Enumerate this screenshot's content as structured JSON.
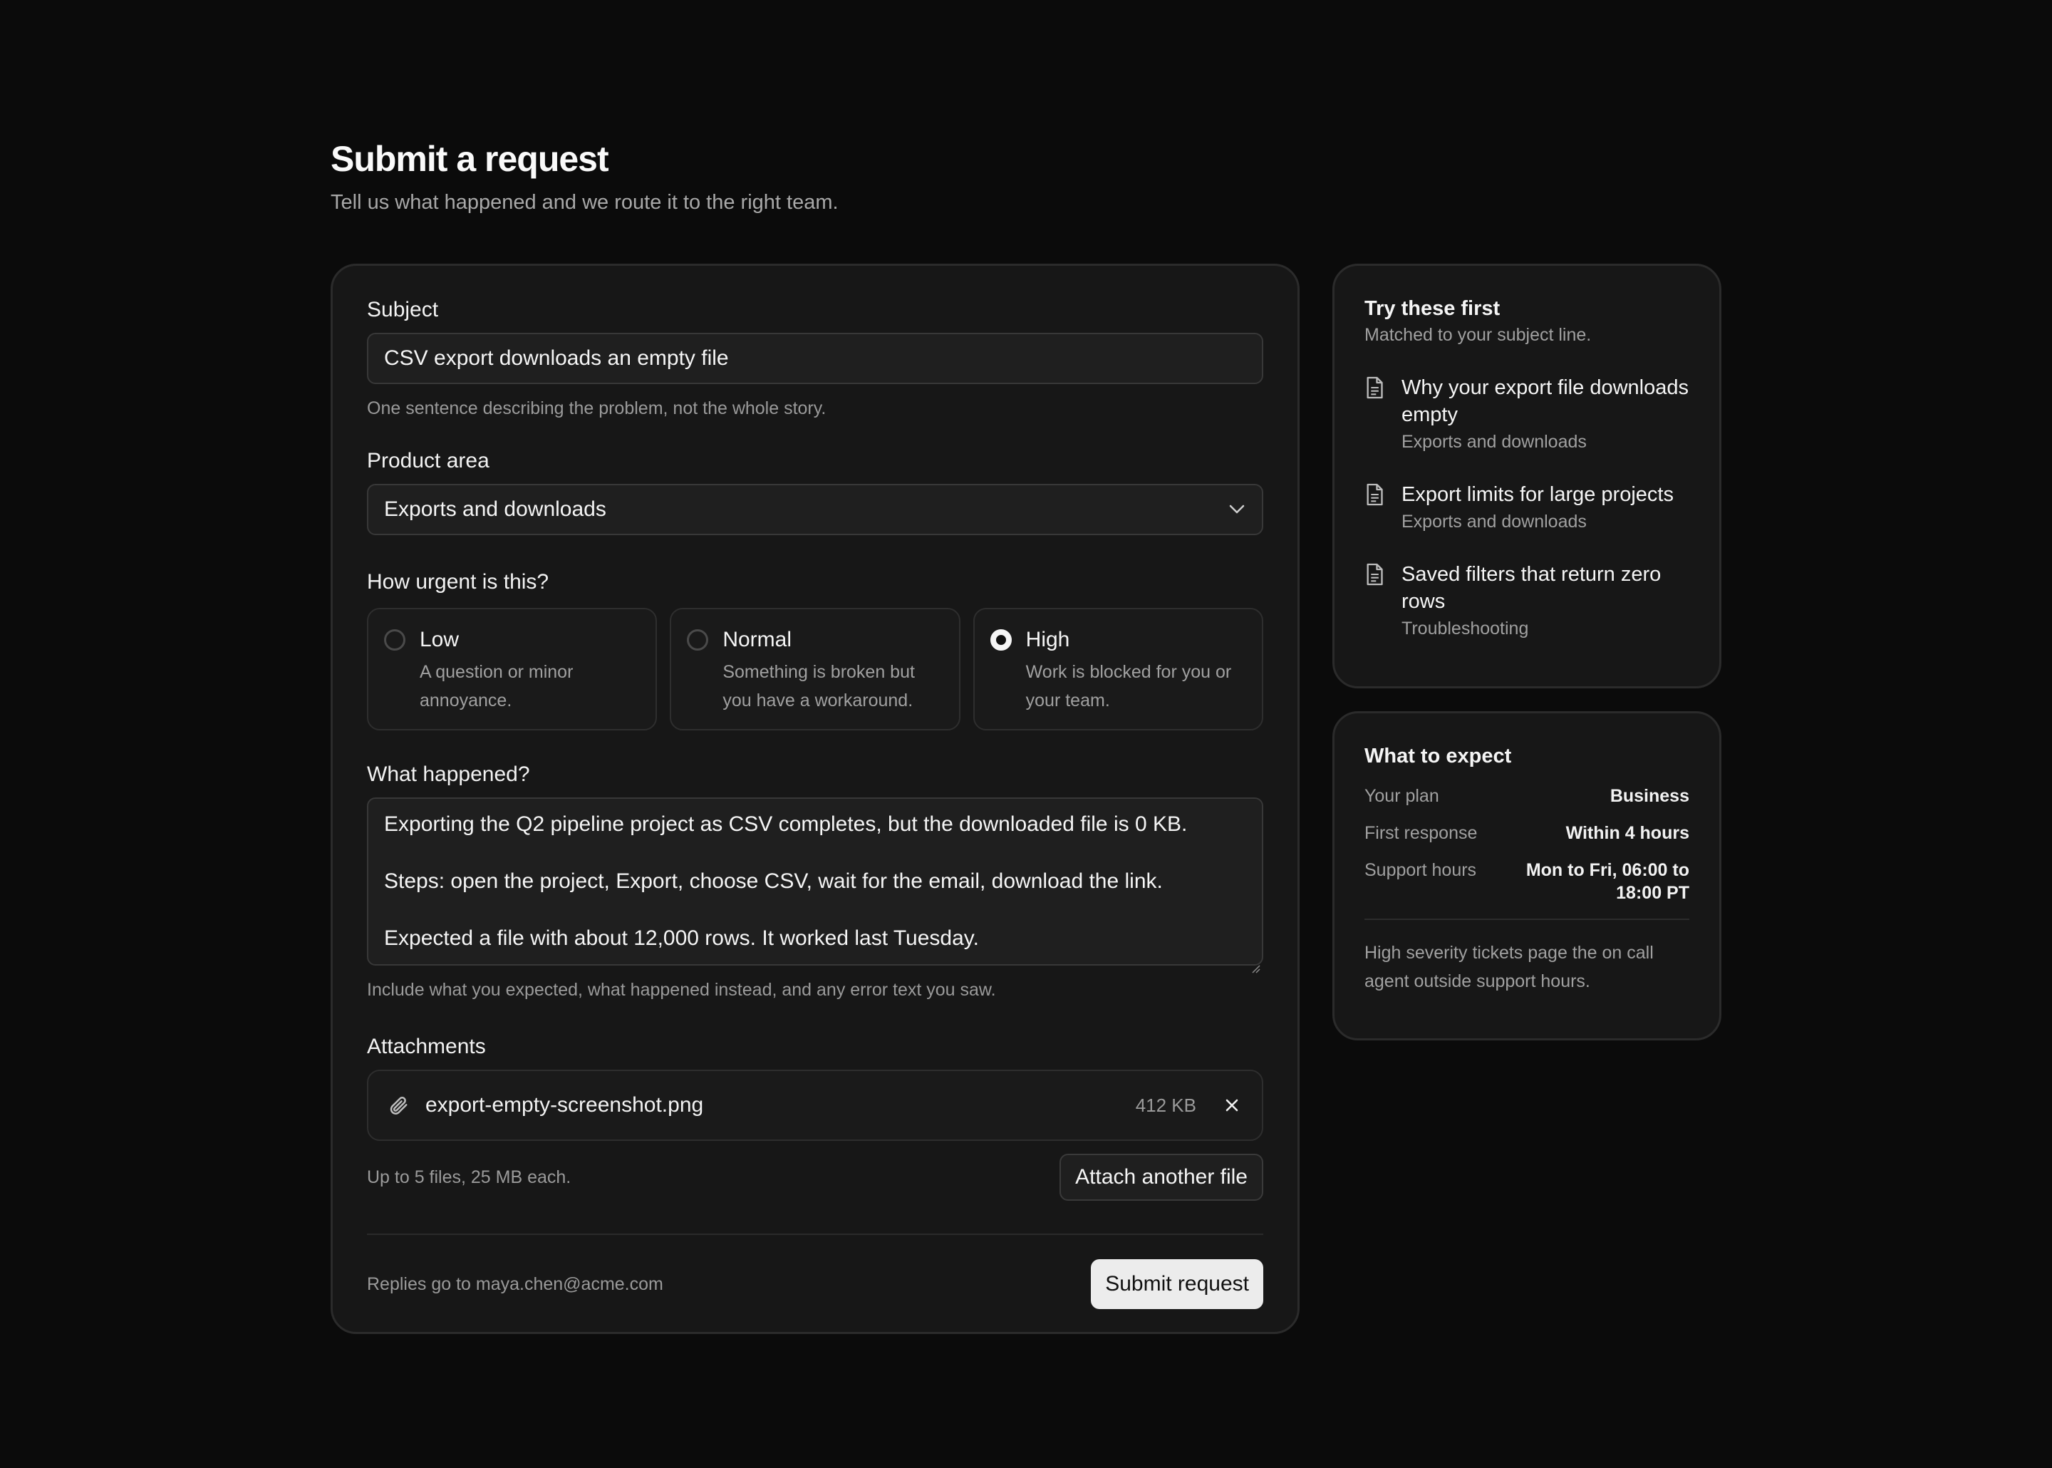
{
  "header": {
    "title": "Submit a request",
    "subtitle": "Tell us what happened and we route it to the right team."
  },
  "form": {
    "subject": {
      "label": "Subject",
      "value": "CSV export downloads an empty file",
      "hint": "One sentence describing the problem, not the whole story."
    },
    "product_area": {
      "label": "Product area",
      "value": "Exports and downloads"
    },
    "urgency": {
      "label": "How urgent is this?",
      "selected": "High",
      "options": [
        {
          "title": "Low",
          "description": "A question or minor annoyance."
        },
        {
          "title": "Normal",
          "description": "Something is broken but you have a workaround."
        },
        {
          "title": "High",
          "description": "Work is blocked for you or your team."
        }
      ]
    },
    "description": {
      "label": "What happened?",
      "lines": [
        "Exporting the Q2 pipeline project as CSV completes, but the downloaded file is 0 KB.",
        "Steps: open the project, Export, choose CSV, wait for the email, download the link.",
        "Expected a file with about 12,000 rows. It worked last Tuesday."
      ],
      "hint": "Include what you expected, what happened instead, and any error text you saw."
    },
    "attachments": {
      "label": "Attachments",
      "files": [
        {
          "name": "export-empty-screenshot.png",
          "size": "412 KB"
        }
      ],
      "limit_text": "Up to 5 files, 25 MB each.",
      "attach_button": "Attach another file"
    },
    "footer": {
      "reply_text": "Replies go to maya.chen@acme.com",
      "submit_button": "Submit request"
    }
  },
  "suggestions": {
    "title": "Try these first",
    "subtitle": "Matched to your subject line.",
    "articles": [
      {
        "title": "Why your export file downloads empty",
        "category": "Exports and downloads"
      },
      {
        "title": "Export limits for large projects",
        "category": "Exports and downloads"
      },
      {
        "title": "Saved filters that return zero rows",
        "category": "Troubleshooting"
      }
    ]
  },
  "expectations": {
    "title": "What to expect",
    "rows": [
      {
        "key": "Your plan",
        "value": "Business"
      },
      {
        "key": "First response",
        "value": "Within 4 hours"
      },
      {
        "key": "Support hours",
        "value": "Mon to Fri, 06:00 to 18:00 PT"
      }
    ],
    "note": "High severity tickets page the on call agent outside support hours."
  },
  "icons": {
    "select_chevron": "chevron-down-icon",
    "attachment": "paperclip-icon",
    "remove": "close-icon",
    "article": "document-icon"
  }
}
